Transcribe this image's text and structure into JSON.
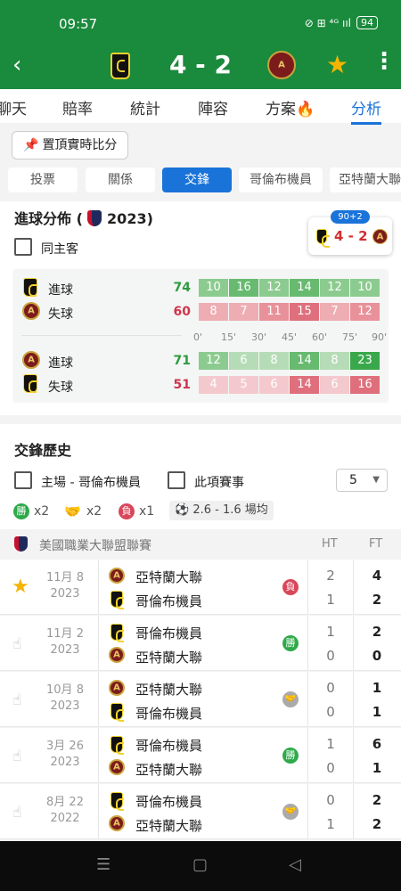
{
  "status": {
    "time": "09:57",
    "icons": "⊘ ⊞ ⁴ᴳ ııl",
    "battery": "94"
  },
  "header": {
    "score": "4 - 2"
  },
  "tabs": [
    "聊天",
    "賠率",
    "統計",
    "陣容",
    "方案🔥",
    "分析"
  ],
  "pin_button": "置頂實時比分",
  "subtabs": [
    "投票",
    "關係",
    "交鋒",
    "哥倫布機員",
    "亞特蘭大聯"
  ],
  "goal_dist": {
    "title": "進球分佈 (",
    "year": "2023)",
    "live_badge": "90+2",
    "live_score": "4 - 2",
    "same_home_away": "同主客",
    "teams": [
      {
        "scored_label": "進球",
        "scored_total": "74",
        "scored": [
          "10",
          "16",
          "12",
          "14",
          "12",
          "10"
        ],
        "conceded_label": "失球",
        "conceded_total": "60",
        "conceded": [
          "8",
          "7",
          "11",
          "15",
          "7",
          "12"
        ]
      },
      {
        "scored_label": "進球",
        "scored_total": "71",
        "scored": [
          "12",
          "6",
          "8",
          "14",
          "8",
          "23"
        ],
        "conceded_label": "失球",
        "conceded_total": "51",
        "conceded": [
          "4",
          "5",
          "6",
          "14",
          "6",
          "16"
        ]
      }
    ],
    "ticks": [
      "0'",
      "15'",
      "30'",
      "45'",
      "60'",
      "75'",
      "90'"
    ]
  },
  "h2h": {
    "title": "交鋒歷史",
    "home_filter": "主場 - 哥倫布機員",
    "comp_filter": "此項賽事",
    "count": "5",
    "win_badge": "勝",
    "win_count": "x2",
    "draw_count": "x2",
    "loss_badge": "負",
    "loss_count": "x1",
    "avg_goals": "2.6 - 1.6 場均",
    "league": "美國職業大聯盟聯賽",
    "col_ht": "HT",
    "col_ft": "FT",
    "matches": [
      {
        "date": "11月 8",
        "year": "2023",
        "home": "亞特蘭大聯",
        "away": "哥倫布機員",
        "result": "負",
        "ht_h": "2",
        "ht_a": "1",
        "ft_h": "4",
        "ft_a": "2"
      },
      {
        "date": "11月 2",
        "year": "2023",
        "home": "哥倫布機員",
        "away": "亞特蘭大聯",
        "result": "勝",
        "ht_h": "1",
        "ht_a": "0",
        "ft_h": "2",
        "ft_a": "0"
      },
      {
        "date": "10月 8",
        "year": "2023",
        "home": "亞特蘭大聯",
        "away": "哥倫布機員",
        "result": "draw",
        "ht_h": "0",
        "ht_a": "0",
        "ft_h": "1",
        "ft_a": "1"
      },
      {
        "date": "3月 26",
        "year": "2023",
        "home": "哥倫布機員",
        "away": "亞特蘭大聯",
        "result": "勝",
        "ht_h": "1",
        "ht_a": "0",
        "ft_h": "6",
        "ft_a": "1"
      },
      {
        "date": "8月 22",
        "year": "2022",
        "home": "哥倫布機員",
        "away": "亞特蘭大聯",
        "result": "draw",
        "ht_h": "0",
        "ht_a": "1",
        "ft_h": "2",
        "ft_a": "2"
      }
    ]
  },
  "colors": {
    "green": "#1a8a3c",
    "blue": "#1a73d9",
    "win": "#2eaa4a",
    "loss": "#d9475b"
  }
}
